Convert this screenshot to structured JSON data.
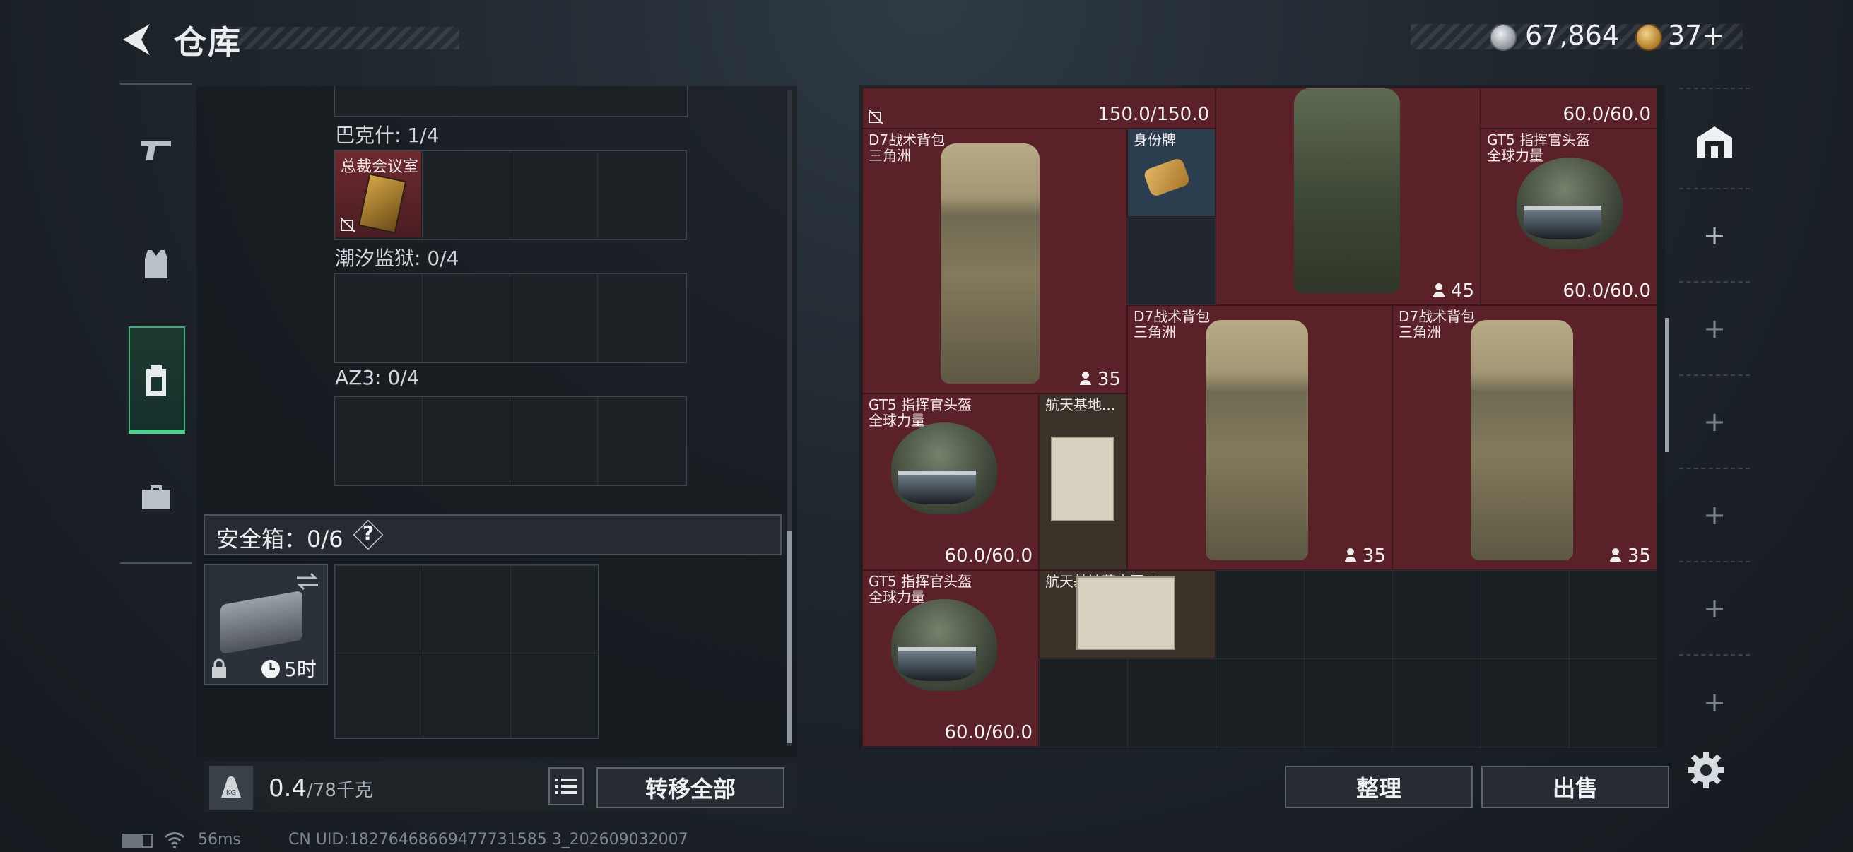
{
  "header": {
    "title": "仓库",
    "currency_silver": "67,864",
    "currency_gold": "37+"
  },
  "sidebar": {
    "items": [
      {
        "icon": "pistol-icon"
      },
      {
        "icon": "vest-icon"
      },
      {
        "icon": "backpack-icon",
        "active": true
      },
      {
        "icon": "toolbox-icon"
      }
    ]
  },
  "left_panel": {
    "sections": [
      {
        "label": "巴克什: 1/4",
        "item": {
          "name": "总裁会议室"
        }
      },
      {
        "label": "潮汐监狱: 0/4"
      },
      {
        "label": "AZ3: 0/4"
      }
    ],
    "safebox": {
      "label": "安全箱：0/6",
      "help": "?",
      "timer": "5时"
    },
    "weight": {
      "value": "0.4",
      "unit": "/78千克"
    },
    "transfer_all": "转移全部"
  },
  "inventory": {
    "items": [
      {
        "id": "top-left-strip",
        "value": "150.0/150.0"
      },
      {
        "id": "top-right-strip",
        "value": "60.0/60.0"
      },
      {
        "id": "bag1",
        "name": "D7战术背包",
        "sub": "三角洲",
        "count": "35"
      },
      {
        "id": "dogtag",
        "name": "身份牌"
      },
      {
        "id": "bag-mid",
        "count": "45"
      },
      {
        "id": "helmet1",
        "name": "GT5 指挥官头盔",
        "sub": "全球力量",
        "value": "60.0/60.0"
      },
      {
        "id": "bag2",
        "name": "D7战术背包",
        "sub": "三角洲",
        "count": "35"
      },
      {
        "id": "bag3",
        "name": "D7战术背包",
        "sub": "三角洲",
        "count": "35"
      },
      {
        "id": "helmet2",
        "name": "GT5 指挥官头盔",
        "sub": "全球力量",
        "value": "60.0/60.0"
      },
      {
        "id": "map1",
        "name": "航天基地..."
      },
      {
        "id": "helmet3",
        "name": "GT5 指挥官头盔",
        "sub": "全球力量",
        "value": "60.0/60.0"
      },
      {
        "id": "map2",
        "name": "航天基地藏宝图-5"
      }
    ],
    "sort": "整理",
    "sell": "出售"
  },
  "right_column": {
    "add_slots": [
      "+",
      "+",
      "+",
      "+",
      "+",
      "+"
    ]
  },
  "status_bar": {
    "ping": "56ms",
    "uid": "CN UID:18276468669477731585 3_202609032007"
  },
  "colors": {
    "accent_green": "#4ad38f",
    "item_red": "#5a2129"
  }
}
